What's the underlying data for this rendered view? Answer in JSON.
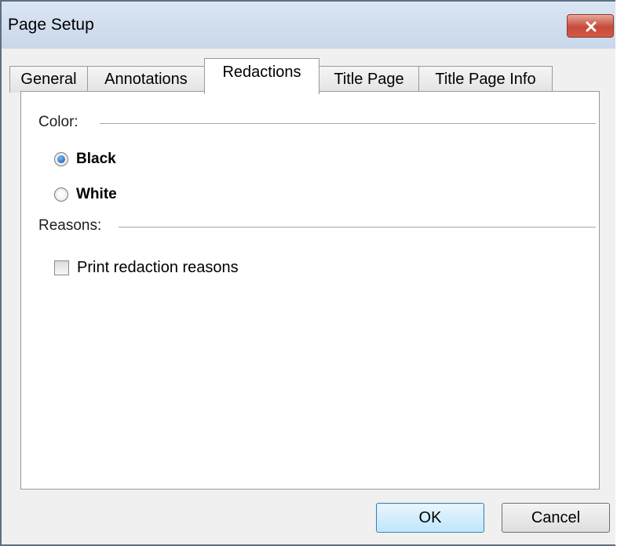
{
  "window": {
    "title": "Page Setup"
  },
  "icons": {
    "close": "close-icon"
  },
  "tabs": [
    {
      "label": "General",
      "active": false
    },
    {
      "label": "Annotations",
      "active": false
    },
    {
      "label": "Redactions",
      "active": true
    },
    {
      "label": "Title Page",
      "active": false
    },
    {
      "label": "Title Page Info",
      "active": false
    }
  ],
  "color_group": {
    "label": "Color:",
    "options": [
      {
        "label": "Black",
        "checked": true
      },
      {
        "label": "White",
        "checked": false
      }
    ]
  },
  "reasons_group": {
    "label": "Reasons:",
    "checkbox_label": "Print redaction reasons",
    "checked": false
  },
  "buttons": {
    "ok": "OK",
    "cancel": "Cancel"
  },
  "colors": {
    "titlebar": "#c8d7ea",
    "close_button": "#c7493a",
    "dialog_bg": "#f0f0f0",
    "default_button": "#bee6fd"
  }
}
